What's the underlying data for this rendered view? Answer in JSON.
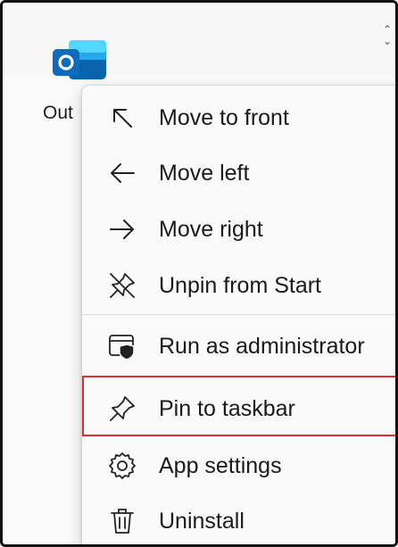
{
  "app": {
    "name_visible": "Out",
    "icon": "outlook-icon",
    "brand_color": "#0f6cbd"
  },
  "context_menu": {
    "items": [
      {
        "label": "Move to front",
        "icon": "arrow-up-left-icon"
      },
      {
        "label": "Move left",
        "icon": "arrow-left-icon"
      },
      {
        "label": "Move right",
        "icon": "arrow-right-icon"
      },
      {
        "label": "Unpin from Start",
        "icon": "unpin-icon"
      },
      {
        "label": "Run as administrator",
        "icon": "shield-window-icon"
      },
      {
        "label": "Pin to taskbar",
        "icon": "pin-icon"
      },
      {
        "label": "App settings",
        "icon": "gear-icon"
      },
      {
        "label": "Uninstall",
        "icon": "trash-icon"
      }
    ],
    "highlighted_item": "Pin to taskbar",
    "highlight_color": "#d9302b"
  }
}
